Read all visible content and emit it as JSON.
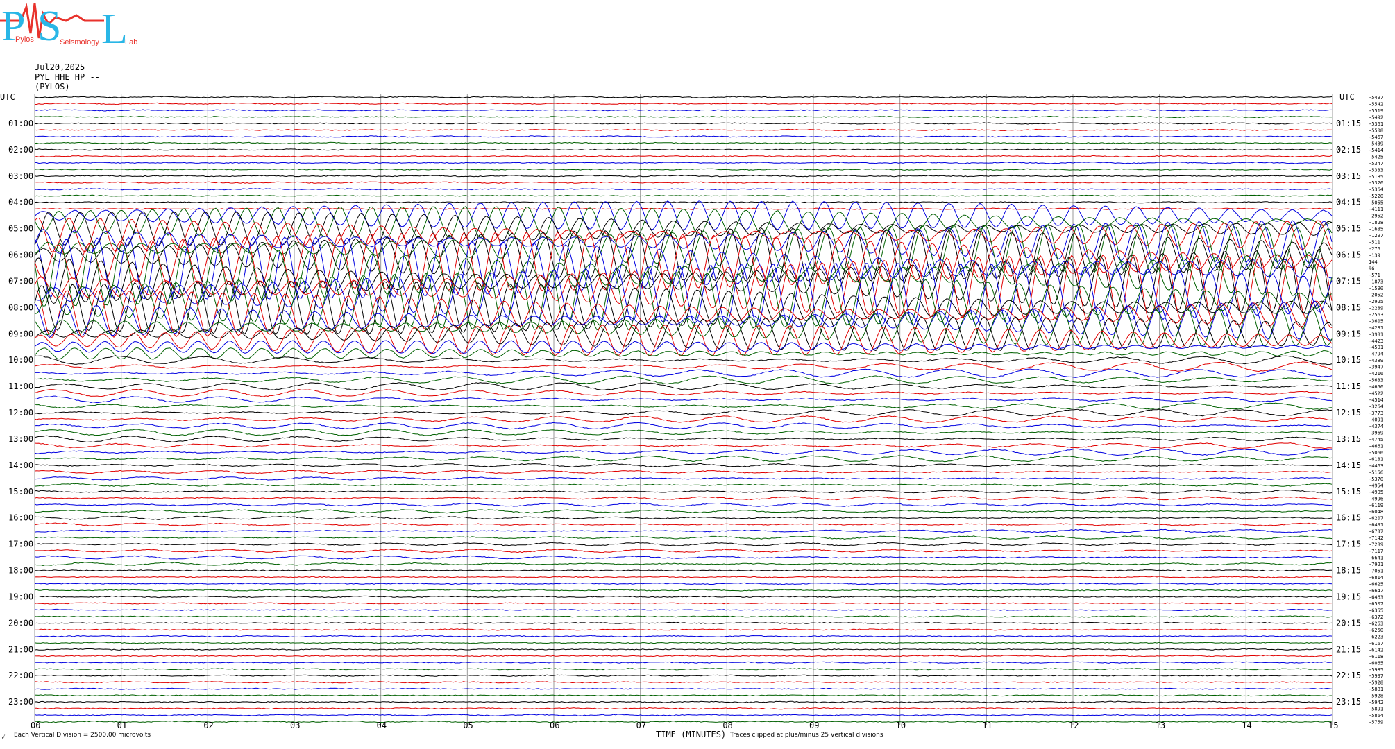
{
  "logo": {
    "letters": [
      "P",
      "S",
      "L"
    ],
    "small_text": [
      "Pylos",
      "Seismology",
      "Lab"
    ],
    "colors": {
      "cyan": "#29b6e6",
      "red": "#e8322c"
    }
  },
  "header": {
    "date": "Jul20,2025",
    "station": "PYL HHE HP --",
    "location": "(PYLOS)"
  },
  "left_axis_title": "UTC",
  "right_axis_title": "UTC",
  "footer": {
    "scale_note": "Each Vertical Division = 2500.00 microvolts",
    "corner_mark": "√",
    "clip_note": "Traces clipped at plus/minus 25 vertical divisions"
  },
  "chart_data": {
    "type": "line",
    "title": "",
    "xlabel": "TIME (MINUTES)",
    "x_range": [
      0,
      15
    ],
    "x_ticks": [
      "00",
      "01",
      "02",
      "03",
      "04",
      "05",
      "06",
      "07",
      "08",
      "09",
      "10",
      "11",
      "12",
      "13",
      "14",
      "15"
    ],
    "rows_per_hour": 4,
    "row_minutes": 15,
    "left_hour_labels": [
      "01:00",
      "02:00",
      "03:00",
      "04:00",
      "05:00",
      "06:00",
      "07:00",
      "08:00",
      "09:00",
      "10:00",
      "11:00",
      "12:00",
      "13:00",
      "14:00",
      "15:00",
      "16:00",
      "17:00",
      "18:00",
      "19:00",
      "20:00",
      "21:00",
      "22:00",
      "23:00"
    ],
    "right_hour_labels": [
      "01:15",
      "02:15",
      "03:15",
      "04:15",
      "05:15",
      "06:15",
      "07:15",
      "08:15",
      "09:15",
      "10:15",
      "11:15",
      "12:15",
      "13:15",
      "14:15",
      "15:15",
      "16:15",
      "17:15",
      "18:15",
      "19:15",
      "20:15",
      "21:15",
      "22:15",
      "23:15"
    ],
    "trace_colors": [
      "#000000",
      "#e00000",
      "#0000e0",
      "#006000"
    ],
    "row_offsets": [
      "-5497",
      "-5542",
      "-5519",
      "-5492",
      "-5361",
      "-5508",
      "-5467",
      "-5439",
      "-5414",
      "-5425",
      "-5347",
      "-5333",
      "-5185",
      "-5326",
      "-5364",
      "-5220",
      "-5055",
      "-4111",
      "-2952",
      "-1828",
      "-1685",
      "-1297",
      "-511",
      "-276",
      "-139",
      "144",
      "96",
      "-571",
      "-1873",
      "-1590",
      "-2052",
      "-2925",
      "-2289",
      "-2563",
      "-3605",
      "-4231",
      "-3981",
      "-4423",
      "-4501",
      "-4794",
      "-4389",
      "-3947",
      "-4216",
      "-5633",
      "-4656",
      "-4522",
      "-4514",
      "-3264",
      "-3773",
      "-4091",
      "-4374",
      "-3969",
      "-4745",
      "-4661",
      "-5066",
      "-6181",
      "-4463",
      "-5156",
      "-5370",
      "-4954",
      "-4905",
      "-4996",
      "-6119",
      "-6048",
      "-6207",
      "-6491",
      "-6737",
      "-7142",
      "-7289",
      "-7117",
      "-6641",
      "-7921",
      "-7051",
      "-6814",
      "-6625",
      "-6642",
      "-6463",
      "-6507",
      "-6355",
      "-6372",
      "-6263",
      "-6250",
      "-6223",
      "-6167",
      "-6142",
      "-6118",
      "-6065",
      "-5985",
      "-5997",
      "-5928",
      "-5881",
      "-5928",
      "-5942",
      "-5891",
      "-5864",
      "-5759"
    ]
  }
}
